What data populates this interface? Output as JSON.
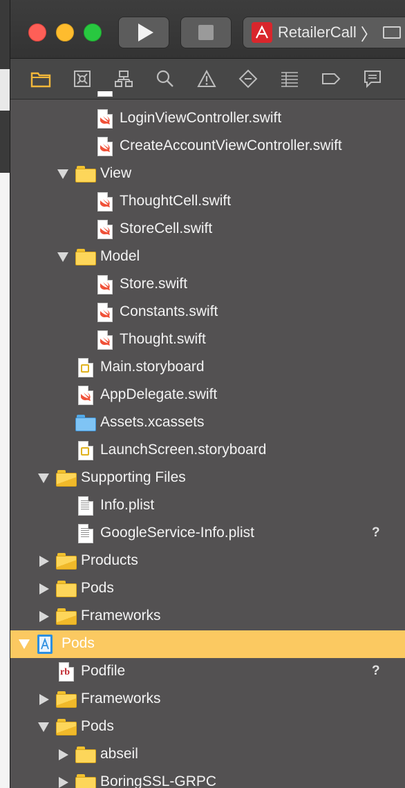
{
  "titlebar": {
    "scheme_label": "RetailerCall",
    "scheme_chevron": "〉"
  },
  "navigator": {
    "icons": [
      "folder-icon",
      "source-control-icon",
      "hierarchy-icon",
      "search-icon",
      "warning-icon",
      "test-icon",
      "debug-icon",
      "breakpoint-icon",
      "report-icon"
    ]
  },
  "tree": {
    "rows": [
      {
        "label": "LoginViewController.swift"
      },
      {
        "label": "CreateAccountViewController.swift"
      },
      {
        "label": "View"
      },
      {
        "label": "ThoughtCell.swift"
      },
      {
        "label": "StoreCell.swift"
      },
      {
        "label": "Model"
      },
      {
        "label": "Store.swift"
      },
      {
        "label": "Constants.swift"
      },
      {
        "label": "Thought.swift"
      },
      {
        "label": "Main.storyboard"
      },
      {
        "label": "AppDelegate.swift"
      },
      {
        "label": "Assets.xcassets"
      },
      {
        "label": "LaunchScreen.storyboard"
      },
      {
        "label": "Supporting Files"
      },
      {
        "label": "Info.plist"
      },
      {
        "label": "GoogleService-Info.plist",
        "status": "?"
      },
      {
        "label": "Products"
      },
      {
        "label": "Pods"
      },
      {
        "label": "Frameworks"
      },
      {
        "label": "Pods"
      },
      {
        "label": "Podfile",
        "status": "?"
      },
      {
        "label": "Frameworks"
      },
      {
        "label": "Pods"
      },
      {
        "label": "abseil"
      },
      {
        "label": "BoringSSL-GRPC"
      }
    ]
  },
  "colors": {
    "selection": "#fbc961",
    "panel": "#535152"
  }
}
